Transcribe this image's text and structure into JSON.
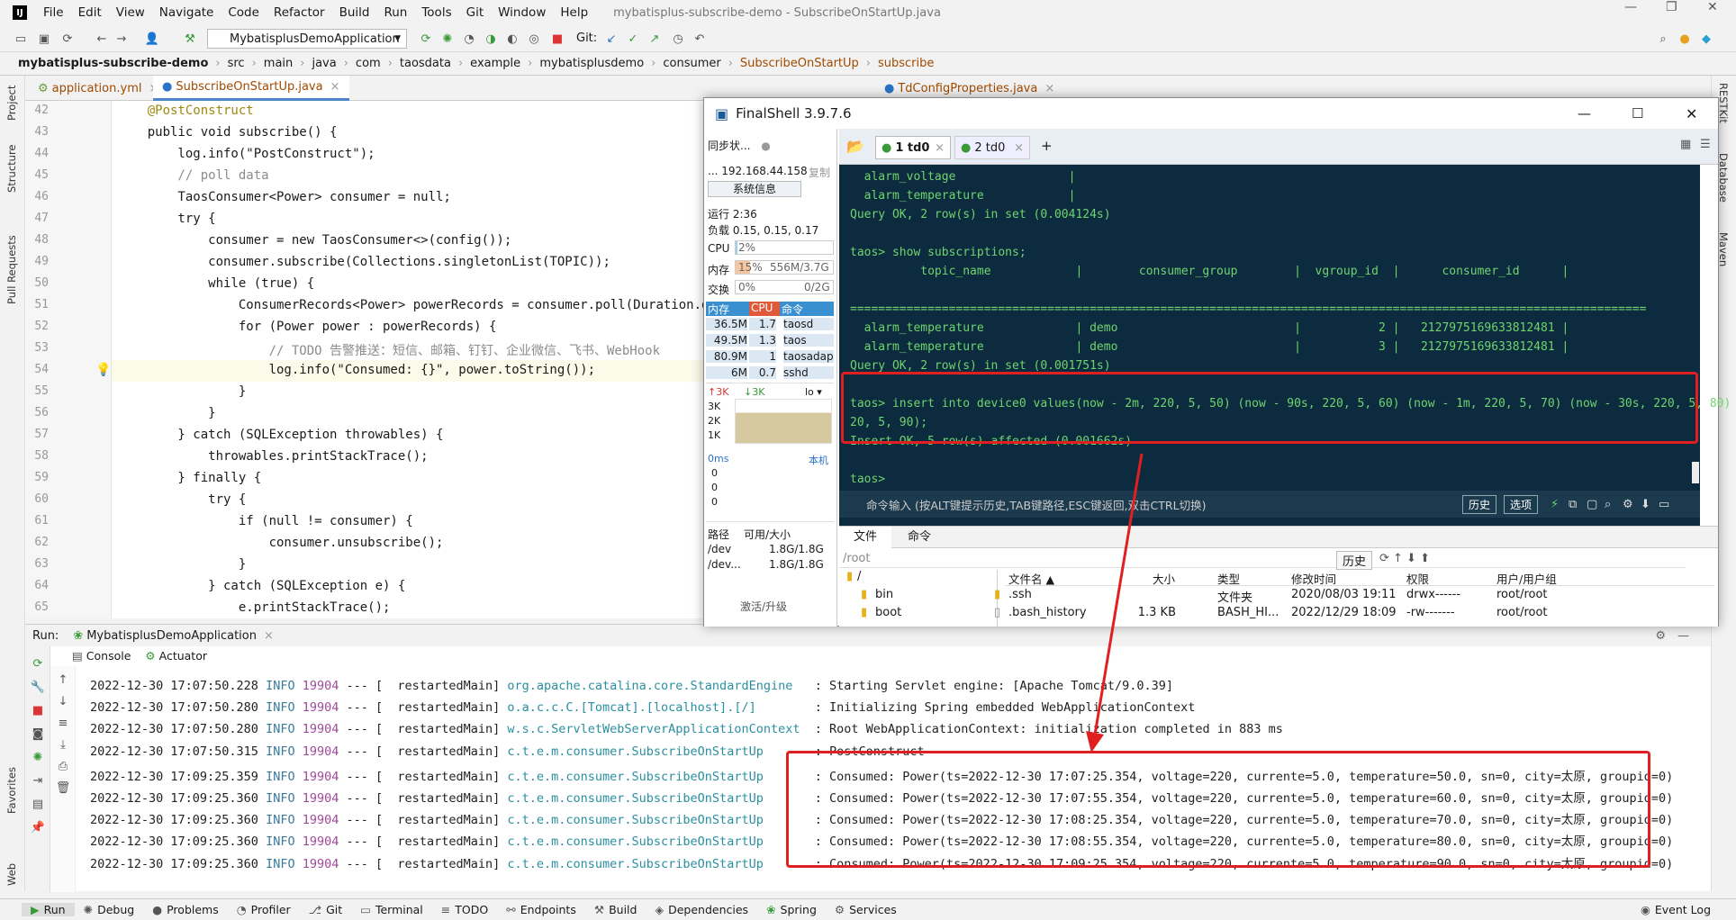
{
  "menubar": {
    "logo": "IJ",
    "items": [
      "File",
      "Edit",
      "View",
      "Navigate",
      "Code",
      "Refactor",
      "Build",
      "Run",
      "Tools",
      "Git",
      "Window",
      "Help"
    ],
    "title": "mybatisplus-subscribe-demo - SubscribeOnStartUp.java"
  },
  "toolbar": {
    "run_config": "MybatisplusDemoApplication",
    "git_label": "Git:"
  },
  "breadcrumb": [
    "mybatisplus-subscribe-demo",
    "src",
    "main",
    "java",
    "com",
    "taosdata",
    "example",
    "mybatisplusdemo",
    "consumer",
    "SubscribeOnStartUp",
    "subscribe"
  ],
  "left_strip": [
    "Project",
    "Structure",
    "Pull Requests",
    "Favorites",
    "Web"
  ],
  "right_strip": [
    "RESTKit",
    "Database",
    "Maven"
  ],
  "editor_tabs": [
    "application.yml",
    "SubscribeOnStartUp.java",
    "TdConfigProperties.java"
  ],
  "line_numbers": [
    "42",
    "43",
    "44",
    "45",
    "46",
    "47",
    "48",
    "49",
    "50",
    "51",
    "52",
    "53",
    "54",
    "55",
    "56",
    "57",
    "58",
    "59",
    "60",
    "61",
    "62",
    "63",
    "64",
    "65"
  ],
  "code": [
    "    @PostConstruct",
    "    public void subscribe() {",
    "        log.info(\"PostConstruct\");",
    "        // poll data",
    "        TaosConsumer<Power> consumer = null;",
    "        try {",
    "            consumer = new TaosConsumer<>(config());",
    "            consumer.subscribe(Collections.singletonList(TOPIC));",
    "            while (true) {",
    "                ConsumerRecords<Power> powerRecords = consumer.poll(Duration.ofMillis",
    "                for (Power power : powerRecords) {",
    "                    // TODO 告警推送：短信、邮箱、钉钉、企业微信、飞书、WebHook",
    "                    log.info(\"Consumed: {}\", power.toString());",
    "                }",
    "            }",
    "        } catch (SQLException throwables) {",
    "            throwables.printStackTrace();",
    "        } finally {",
    "            try {",
    "                if (null != consumer) {",
    "                    consumer.unsubscribe();",
    "                }",
    "            } catch (SQLException e) {",
    "                e.printStackTrace();"
  ],
  "run": {
    "label": "Run:",
    "config": "MybatisplusDemoApplication",
    "tabs": [
      "Console",
      "Actuator"
    ]
  },
  "log_lines": [
    {
      "ts": "2022-12-30 17:07:50.228",
      "level": "INFO",
      "pid": "19904",
      "sep": "---",
      "thread": "[  restartedMain]",
      "cls": "org.apache.catalina.core.StandardEngine  ",
      "msg": ": Starting Servlet engine: [Apache Tomcat/9.0.39]"
    },
    {
      "ts": "2022-12-30 17:07:50.280",
      "level": "INFO",
      "pid": "19904",
      "sep": "---",
      "thread": "[  restartedMain]",
      "cls": "o.a.c.c.C.[Tomcat].[localhost].[/]       ",
      "msg": ": Initializing Spring embedded WebApplicationContext"
    },
    {
      "ts": "2022-12-30 17:07:50.280",
      "level": "INFO",
      "pid": "19904",
      "sep": "---",
      "thread": "[  restartedMain]",
      "cls": "w.s.c.ServletWebServerApplicationContext ",
      "msg": ": Root WebApplicationContext: initialization completed in 883 ms"
    },
    {
      "ts": "2022-12-30 17:07:50.315",
      "level": "INFO",
      "pid": "19904",
      "sep": "---",
      "thread": "[  restartedMain]",
      "cls": "c.t.e.m.consumer.SubscribeOnStartUp      ",
      "msg": ": PostConstruct"
    },
    {
      "ts": "2022-12-30 17:09:25.359",
      "level": "INFO",
      "pid": "19904",
      "sep": "---",
      "thread": "[  restartedMain]",
      "cls": "c.t.e.m.consumer.SubscribeOnStartUp      ",
      "msg": ": Consumed: Power(ts=2022-12-30 17:07:25.354, voltage=220, currente=5.0, temperature=50.0, sn=0, city=太原, groupid=0)"
    },
    {
      "ts": "2022-12-30 17:09:25.360",
      "level": "INFO",
      "pid": "19904",
      "sep": "---",
      "thread": "[  restartedMain]",
      "cls": "c.t.e.m.consumer.SubscribeOnStartUp      ",
      "msg": ": Consumed: Power(ts=2022-12-30 17:07:55.354, voltage=220, currente=5.0, temperature=60.0, sn=0, city=太原, groupid=0)"
    },
    {
      "ts": "2022-12-30 17:09:25.360",
      "level": "INFO",
      "pid": "19904",
      "sep": "---",
      "thread": "[  restartedMain]",
      "cls": "c.t.e.m.consumer.SubscribeOnStartUp      ",
      "msg": ": Consumed: Power(ts=2022-12-30 17:08:25.354, voltage=220, currente=5.0, temperature=70.0, sn=0, city=太原, groupid=0)"
    },
    {
      "ts": "2022-12-30 17:09:25.360",
      "level": "INFO",
      "pid": "19904",
      "sep": "---",
      "thread": "[  restartedMain]",
      "cls": "c.t.e.m.consumer.SubscribeOnStartUp      ",
      "msg": ": Consumed: Power(ts=2022-12-30 17:08:55.354, voltage=220, currente=5.0, temperature=80.0, sn=0, city=太原, groupid=0)"
    },
    {
      "ts": "2022-12-30 17:09:25.360",
      "level": "INFO",
      "pid": "19904",
      "sep": "---",
      "thread": "[  restartedMain]",
      "cls": "c.t.e.m.consumer.SubscribeOnStartUp      ",
      "msg": ": Consumed: Power(ts=2022-12-30 17:09:25.354, voltage=220, currente=5.0, temperature=90.0, sn=0, city=太原, groupid=0)"
    }
  ],
  "statusbar": [
    "Run",
    "Debug",
    "Problems",
    "Profiler",
    "Git",
    "Terminal",
    "TODO",
    "Endpoints",
    "Build",
    "Dependencies",
    "Spring",
    "Services"
  ],
  "statusbar_right": "Event Log",
  "finalshell": {
    "title": "FinalShell 3.9.7.6",
    "sync": "同步状...",
    "ip": "... 192.168.44.158",
    "copy": "复制",
    "sysinfo": "系统信息",
    "uptime": "运行 2:36",
    "load": "负载 0.15, 0.15, 0.17",
    "cpu_label": "CPU",
    "cpu_val": "2%",
    "cpu_pct": 0.02,
    "mem_label": "内存",
    "mem_pct_text": "15%",
    "mem_val": "556M/3.7G",
    "mem_pct": 0.15,
    "swap_label": "交换",
    "swap_pct_text": "0%",
    "swap_val": "0/2G",
    "proc_head": [
      "内存",
      "CPU",
      "命令"
    ],
    "procs": [
      [
        "36.5M",
        "1.7",
        "taosd"
      ],
      [
        "49.5M",
        "1.3",
        "taos"
      ],
      [
        "80.9M",
        "1",
        "taosadap"
      ],
      [
        "6M",
        "0.7",
        "sshd"
      ]
    ],
    "net_up": "↑3K",
    "net_down": "↓3K",
    "net_if": "lo",
    "net_scale": [
      "3K",
      "2K",
      "1K"
    ],
    "ping_label": "0ms",
    "ping_host": "本机",
    "ping_vals": [
      "0",
      "0",
      "0"
    ],
    "disk_head": [
      "路径",
      "可用/大小"
    ],
    "disks": [
      [
        "/dev",
        "1.8G/1.8G"
      ],
      [
        "/dev...",
        "1.8G/1.8G"
      ]
    ],
    "activate": "激活/升级",
    "tabs": [
      "1 td0",
      "2 td0"
    ],
    "terminal": [
      "  alarm_voltage                |",
      "  alarm_temperature            |",
      "Query OK, 2 row(s) in set (0.004124s)",
      "",
      "taos> show subscriptions;",
      "          topic_name            |        consumer_group        |  vgroup_id  |      consumer_id      |",
      "",
      "=================================================================================================================",
      "  alarm_temperature             | demo                         |           2 |   2127975169633812481 |",
      "  alarm_temperature             | demo                         |           3 |   2127975169633812481 |",
      "Query OK, 2 row(s) in set (0.001751s)",
      "",
      "taos> insert into device0 values(now - 2m, 220, 5, 50) (now - 90s, 220, 5, 60) (now - 1m, 220, 5, 70) (now - 30s, 220, 5, 80) (now, 2",
      "20, 5, 90);",
      "Insert OK, 5 row(s) affected (0.001662s)",
      "",
      "taos>"
    ],
    "cmd_hint": "命令输入 (按ALT键提示历史,TAB键路径,ESC键返回,双击CTRL切换)",
    "cmd_btns": [
      "历史",
      "选项"
    ],
    "file_tabs": [
      "文件",
      "命令"
    ],
    "path": "/root",
    "history_btn": "历史",
    "tree": [
      "/",
      "bin",
      "boot"
    ],
    "file_cols": [
      "文件名 ▲",
      "大小",
      "类型",
      "修改时间",
      "权限",
      "用户/用户组"
    ],
    "files": [
      [
        ".ssh",
        "",
        "文件夹",
        "2020/08/03 19:11",
        "drwx------",
        "root/root"
      ],
      [
        ".bash_history",
        "1.3 KB",
        "BASH_HI...",
        "2022/12/29 18:09",
        "-rw-------",
        "root/root"
      ]
    ]
  },
  "colors": {
    "red_highlight": "#e02020",
    "term_bg": "#0d2b3e",
    "term_text": "#6fd46f"
  }
}
